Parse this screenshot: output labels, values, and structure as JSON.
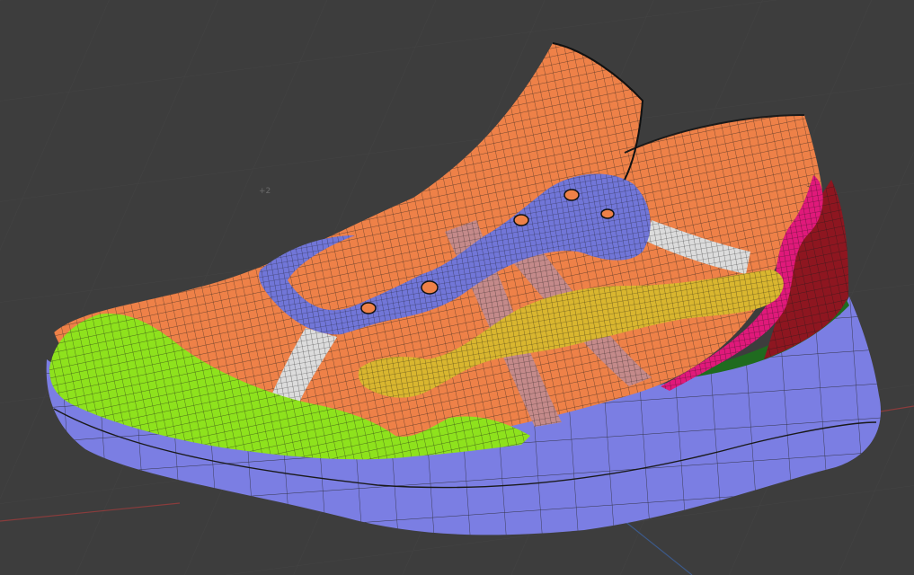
{
  "viewport": {
    "overlay_text": "+2",
    "background": "#3d3d3d",
    "grid_color": "#4a4a4a",
    "axis_x_color": "#8a3c3c",
    "axis_y_color": "#3c5a8a"
  },
  "model": {
    "name": "sneaker-mesh",
    "parts": [
      {
        "name": "sole",
        "color": "#7b7ee3"
      },
      {
        "name": "upper",
        "color": "#ee8148"
      },
      {
        "name": "toe-cap",
        "color": "#8ee21d"
      },
      {
        "name": "lace-panel",
        "color": "#7176d8"
      },
      {
        "name": "side-stripe",
        "color": "#d9b62f"
      },
      {
        "name": "diagonal-strap",
        "color": "#c48a8a"
      },
      {
        "name": "lace-strap",
        "color": "#dcdcdc"
      },
      {
        "name": "heel-trim",
        "color": "#e0197a"
      },
      {
        "name": "heel-counter",
        "color": "#8e1620"
      },
      {
        "name": "heel-base",
        "color": "#1f6b1f"
      },
      {
        "name": "collar",
        "color": "#ee8148"
      }
    ]
  }
}
